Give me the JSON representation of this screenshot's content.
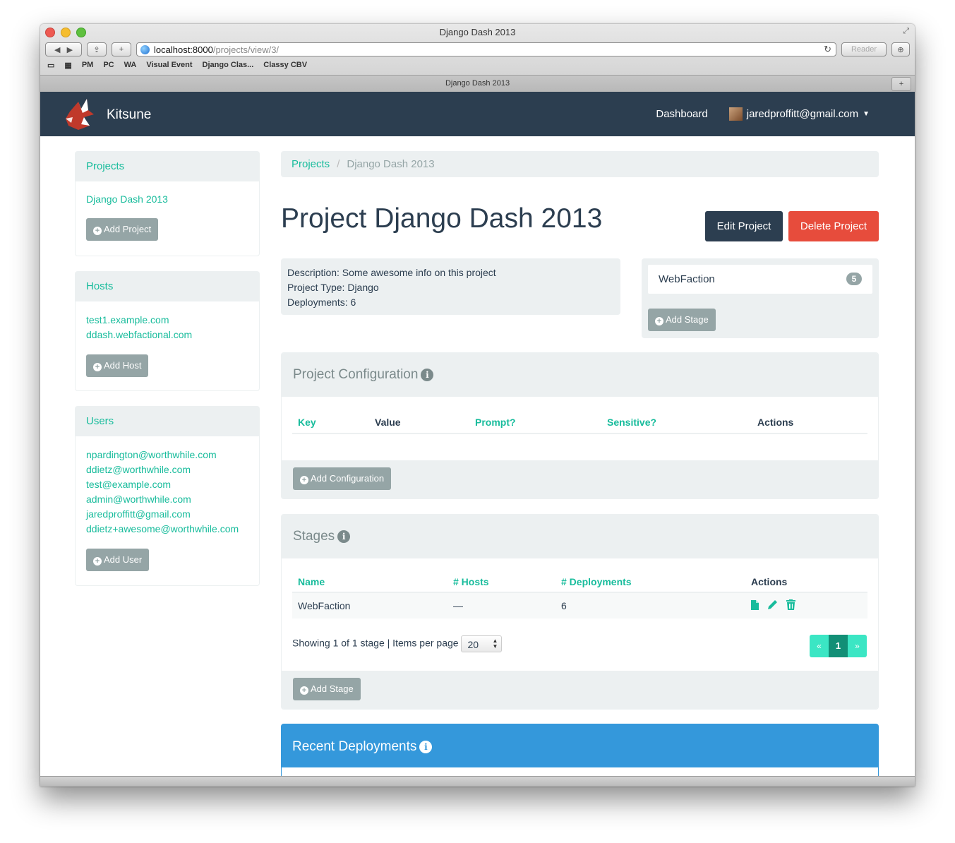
{
  "browser": {
    "window_title": "Django Dash 2013",
    "url_host": "localhost:8000",
    "url_path": "/projects/view/3/",
    "reader_label": "Reader",
    "bookmarks": [
      "PM",
      "PC",
      "WA",
      "Visual Event",
      "Django Clas...",
      "Classy CBV"
    ],
    "tab_title": "Django Dash 2013"
  },
  "navbar": {
    "brand": "Kitsune",
    "dashboard": "Dashboard",
    "user_email": "jaredproffitt@gmail.com"
  },
  "sidebar": {
    "projects": {
      "title": "Projects",
      "items": [
        "Django Dash 2013"
      ],
      "add_label": "Add Project"
    },
    "hosts": {
      "title": "Hosts",
      "items": [
        "test1.example.com",
        "ddash.webfactional.com"
      ],
      "add_label": "Add Host"
    },
    "users": {
      "title": "Users",
      "items": [
        "npardington@worthwhile.com",
        "ddietz@worthwhile.com",
        "test@example.com",
        "admin@worthwhile.com",
        "jaredproffitt@gmail.com",
        "ddietz+awesome@worthwhile.com"
      ],
      "add_label": "Add User"
    }
  },
  "breadcrumb": {
    "root": "Projects",
    "sep": "/",
    "current": "Django Dash 2013"
  },
  "main": {
    "title": "Project Django Dash 2013",
    "edit_label": "Edit Project",
    "delete_label": "Delete Project",
    "description": "Description: Some awesome info on this project",
    "project_type": "Project Type: Django",
    "deployments": "Deployments: 6",
    "stage_box": {
      "name": "WebFaction",
      "count": "5",
      "add_label": "Add Stage"
    }
  },
  "config": {
    "title": "Project Configuration",
    "columns": [
      "Key",
      "Value",
      "Prompt?",
      "Sensitive?",
      "Actions"
    ],
    "add_label": "Add Configuration"
  },
  "stages": {
    "title": "Stages",
    "columns": [
      "Name",
      "# Hosts",
      "# Deployments",
      "Actions"
    ],
    "rows": [
      {
        "name": "WebFaction",
        "hosts": "—",
        "deployments": "6"
      }
    ],
    "showing": "Showing 1 of 1 stage | Items per page",
    "per_page": "20",
    "pager": {
      "prev": "«",
      "page": "1",
      "next": "»"
    },
    "add_label": "Add Stage"
  },
  "recent": {
    "title": "Recent Deployments"
  },
  "colors": {
    "navbar": "#2c3e50",
    "accent": "#18bc9c",
    "danger": "#e74c3c",
    "info": "#3498db",
    "muted": "#95a5a6"
  }
}
